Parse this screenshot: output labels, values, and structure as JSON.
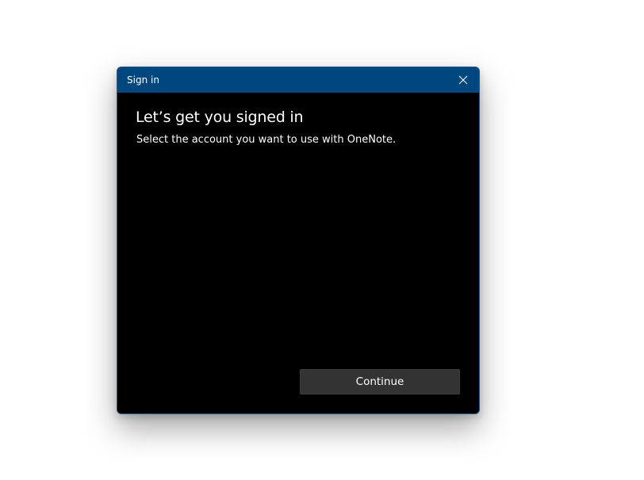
{
  "dialog": {
    "title": "Sign in",
    "heading": "Let’s get you signed in",
    "subtext": "Select the account you want to use with OneNote.",
    "continue_label": "Continue",
    "close_icon": "close-icon"
  },
  "colors": {
    "titlebar": "#00467f",
    "body": "#000000",
    "button": "#333333",
    "text": "#ffffff"
  }
}
